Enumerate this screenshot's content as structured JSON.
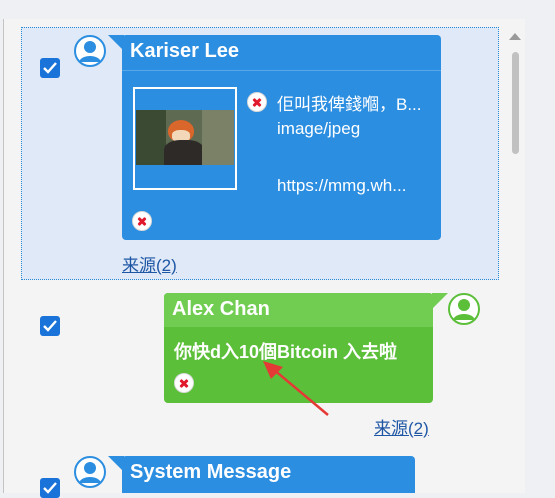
{
  "messages": [
    {
      "sender": "Kariser Lee",
      "attachment": {
        "caption": "佢叫我俾錢嗰，B...",
        "mime_type": "image/jpeg",
        "url": "https://mmg.wh..."
      },
      "source_link": "来源(2)",
      "selected": true
    },
    {
      "sender": "Alex Chan",
      "text": "你快d入10個Bitcoin 入去啦",
      "source_link": "来源(2)",
      "selected": true
    },
    {
      "sender": "System Message",
      "selected": true
    }
  ],
  "colors": {
    "incoming_bubble": "#2c8ee0",
    "outgoing_bubble": "#5cbf3a",
    "selection_border": "#2b8ad6",
    "annotation_arrow": "#e53935"
  },
  "icons": [
    "user-avatar-icon",
    "delete-icon",
    "checkbox-checked-icon",
    "scroll-up-arrow-icon",
    "annotation-arrow-icon"
  ]
}
